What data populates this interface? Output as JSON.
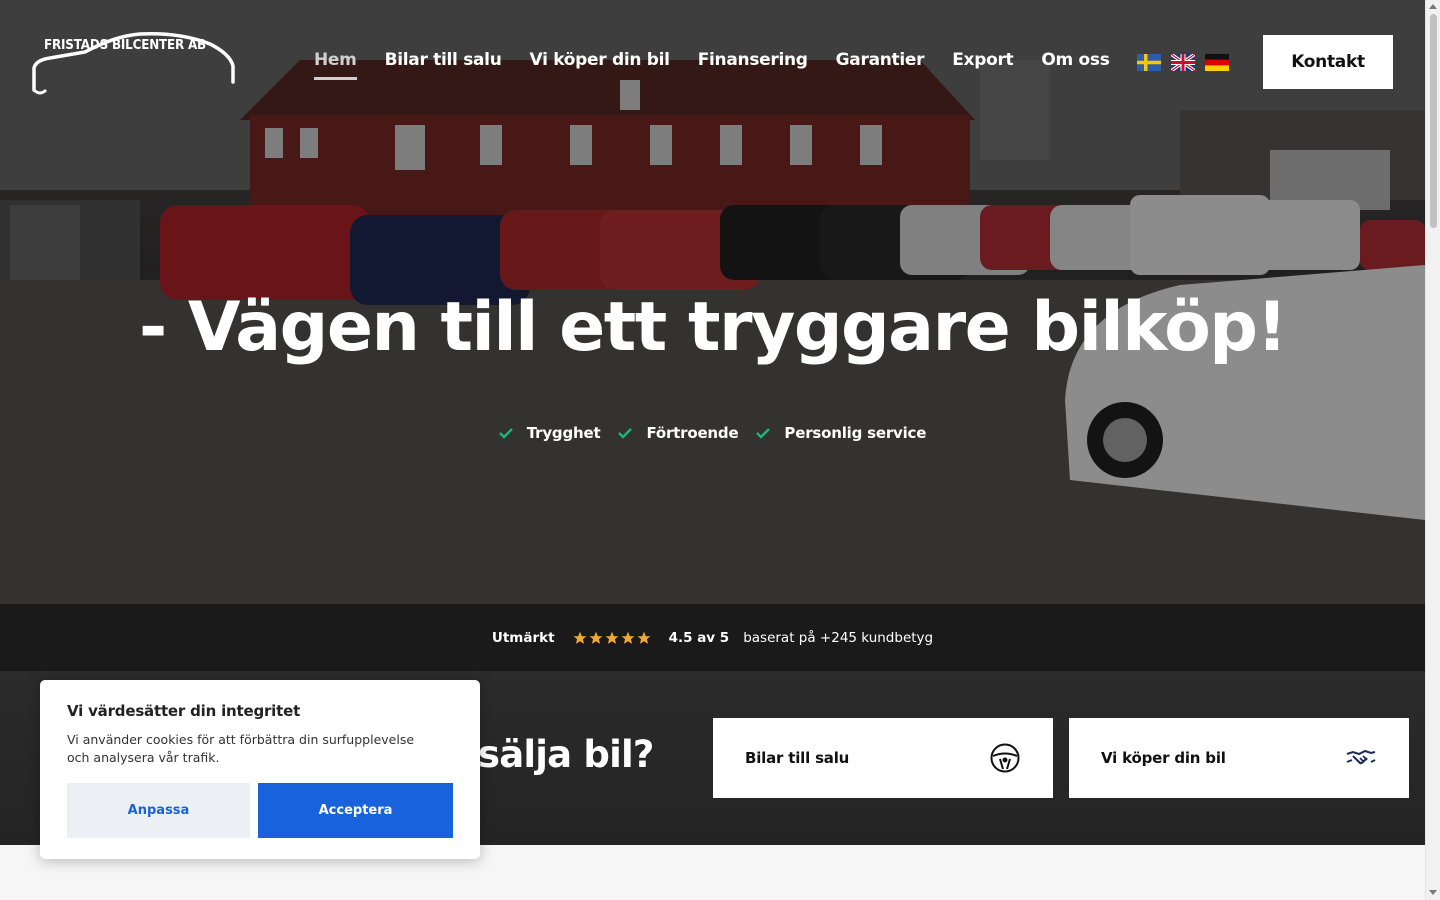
{
  "brand": {
    "logo_text": "FRISTADS BILCENTER AB"
  },
  "nav": {
    "items": [
      {
        "label": "Hem",
        "active": true
      },
      {
        "label": "Bilar till salu"
      },
      {
        "label": "Vi köper din bil"
      },
      {
        "label": "Finansering"
      },
      {
        "label": "Garantier"
      },
      {
        "label": "Export"
      },
      {
        "label": "Om oss"
      }
    ],
    "languages": [
      "swedish-flag-icon",
      "uk-flag-icon",
      "german-flag-icon"
    ],
    "contact_label": "Kontakt"
  },
  "hero": {
    "title": "- Vägen till ett tryggare bilköp!",
    "features": [
      "Trygghet",
      "Förtroende",
      "Personlig service"
    ],
    "check_color": "#1bb77a"
  },
  "rating": {
    "label": "Utmärkt",
    "score": "4.5 av 5",
    "stars": 4.5,
    "suffix": "baserat på +245 kundbetyg",
    "star_color": "#f2a93b"
  },
  "cta": {
    "title_partial": "sälja bil?",
    "cards": [
      {
        "label": "Bilar till salu",
        "icon": "steering-wheel-icon"
      },
      {
        "label": "Vi köper din bil",
        "icon": "handshake-icon"
      }
    ]
  },
  "cookie": {
    "title": "Vi värdesätter din integritet",
    "text": "Vi använder cookies för att förbättra din surfupplevelse och analysera vår trafik.",
    "customize_label": "Anpassa",
    "accept_label": "Acceptera",
    "accent": "#1863dc"
  }
}
